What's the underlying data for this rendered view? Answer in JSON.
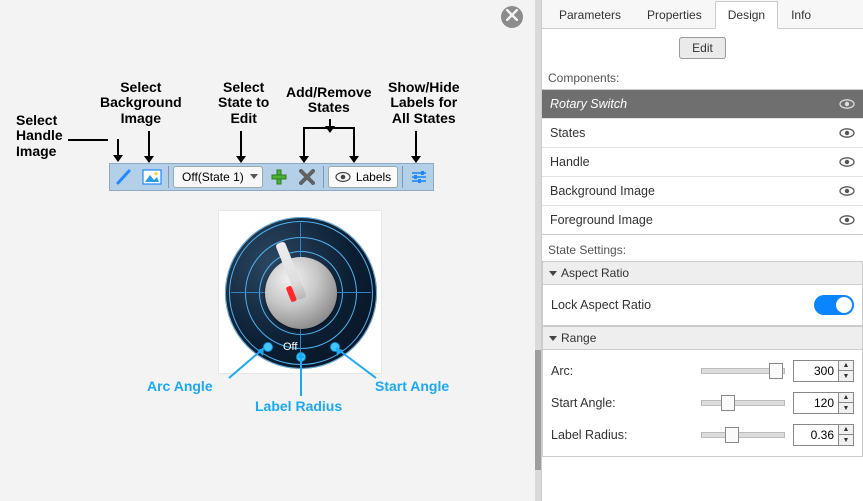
{
  "annotations": {
    "handle": "Select\nHandle\nImage",
    "background": "Select\nBackground\nImage",
    "state": "Select\nState to\nEdit",
    "addremove": "Add/Remove\nStates",
    "showhide": "Show/Hide\nLabels for\nAll States",
    "arc_angle": "Arc Angle",
    "label_radius": "Label Radius",
    "start_angle": "Start Angle"
  },
  "toolbar": {
    "combo_label": "Off(State 1)",
    "labels_button": "Labels"
  },
  "rotary": {
    "off_label": "Off"
  },
  "right": {
    "tabs": [
      "Parameters",
      "Properties",
      "Design",
      "Info"
    ],
    "active_tab": 2,
    "edit_label": "Edit",
    "components_label": "Components:",
    "components": [
      "Rotary Switch",
      "States",
      "Handle",
      "Background Image",
      "Foreground Image"
    ],
    "selected_component": 0,
    "state_settings_label": "State Settings:",
    "aspect_ratio_header": "Aspect Ratio",
    "lock_aspect_label": "Lock Aspect Ratio",
    "lock_aspect_on": true,
    "range_header": "Range",
    "arc_label": "Arc:",
    "arc_value": "300",
    "start_angle_label": "Start Angle:",
    "start_angle_value": "120",
    "label_radius_label": "Label Radius:",
    "label_radius_value": "0.36"
  },
  "chart_data": {
    "type": "table",
    "title": "Rotary Switch Range Settings",
    "rows": [
      {
        "name": "Arc",
        "value": 300
      },
      {
        "name": "Start Angle",
        "value": 120
      },
      {
        "name": "Label Radius",
        "value": 0.36
      }
    ]
  }
}
